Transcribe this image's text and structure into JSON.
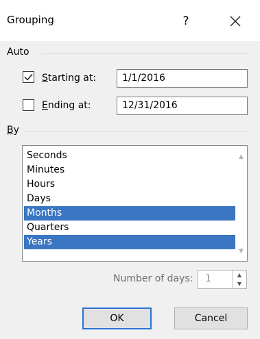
{
  "window": {
    "title": "Grouping",
    "help_label": "?",
    "close_icon": "close-icon"
  },
  "auto": {
    "title": "Auto",
    "starting": {
      "checked": true,
      "label": "Starting at:",
      "value": "1/1/2016"
    },
    "ending": {
      "checked": false,
      "label": "Ending at:",
      "value": "12/31/2016"
    }
  },
  "by": {
    "title": "By",
    "items": [
      {
        "label": "Seconds",
        "selected": false
      },
      {
        "label": "Minutes",
        "selected": false
      },
      {
        "label": "Hours",
        "selected": false
      },
      {
        "label": "Days",
        "selected": false
      },
      {
        "label": "Months",
        "selected": true
      },
      {
        "label": "Quarters",
        "selected": false
      },
      {
        "label": "Years",
        "selected": true
      }
    ]
  },
  "days": {
    "label": "Number of days:",
    "value": "1"
  },
  "buttons": {
    "ok": "OK",
    "cancel": "Cancel"
  },
  "colors": {
    "selection": "#3a76c2",
    "default_button_border": "#2b73d3"
  }
}
